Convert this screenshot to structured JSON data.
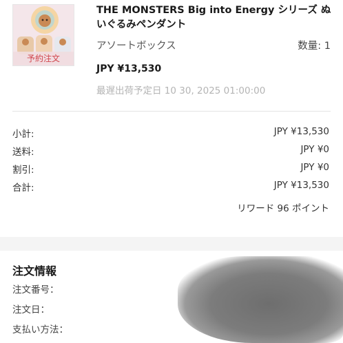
{
  "product": {
    "badge": "予約注文",
    "title": "THE MONSTERS Big into Energy シリーズ ぬいぐるみペンダント",
    "variant": "アソートボックス",
    "quantity": "数量: 1",
    "price": "JPY ¥13,530",
    "ship_date": "最遅出荷予定日 10 30, 2025 01:00:00"
  },
  "summary": {
    "rows": [
      {
        "label": "小計:",
        "value": "JPY ¥13,530"
      },
      {
        "label": "送料:",
        "value": "JPY ¥0"
      },
      {
        "label": "割引:",
        "value": "JPY ¥0"
      },
      {
        "label": "合計:",
        "value": "JPY ¥13,530"
      }
    ],
    "reward": "リワード 96 ポイント"
  },
  "order_info": {
    "heading": "注文情報",
    "order_number_label": "注文番号：",
    "order_date_label": "注文日：",
    "payment_method_label": "支払い方法："
  },
  "colors": {
    "badge_text": "#d0464c",
    "ship_date_text": "#b4b4b4",
    "section_gap": "#f4f4f4"
  }
}
